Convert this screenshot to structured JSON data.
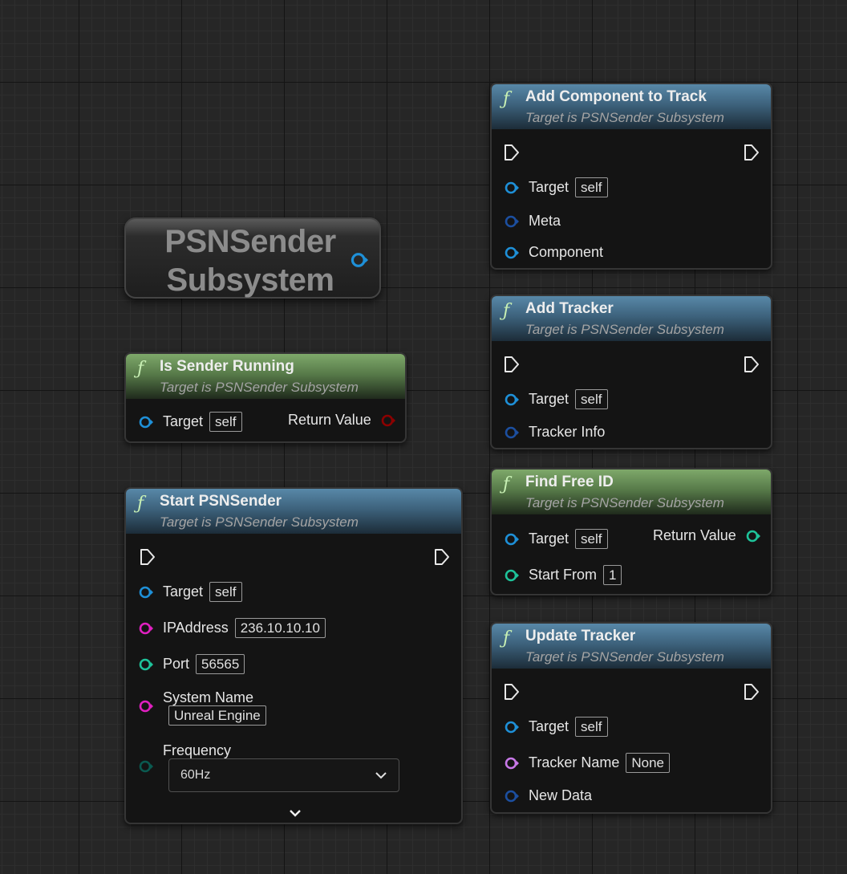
{
  "graph": {
    "subsystem_node": {
      "title_line1": "PSNSender",
      "title_line2": "Subsystem"
    },
    "is_sender_running": {
      "title": "Is Sender Running",
      "subtitle": "Target is PSNSender Subsystem",
      "target_label": "Target",
      "target_value": "self",
      "return_label": "Return Value"
    },
    "start_psn_sender": {
      "title": "Start PSNSender",
      "subtitle": "Target is PSNSender Subsystem",
      "target_label": "Target",
      "target_value": "self",
      "ip_label": "IPAddress",
      "ip_value": "236.10.10.10",
      "port_label": "Port",
      "port_value": "56565",
      "system_name_label": "System Name",
      "system_name_value": "Unreal Engine",
      "frequency_label": "Frequency",
      "frequency_value": "60Hz"
    },
    "add_component_to_track": {
      "title": "Add Component to Track",
      "subtitle": "Target is PSNSender Subsystem",
      "target_label": "Target",
      "target_value": "self",
      "meta_label": "Meta",
      "component_label": "Component"
    },
    "add_tracker": {
      "title": "Add Tracker",
      "subtitle": "Target is PSNSender Subsystem",
      "target_label": "Target",
      "target_value": "self",
      "tracker_info_label": "Tracker Info"
    },
    "find_free_id": {
      "title": "Find Free ID",
      "subtitle": "Target is PSNSender Subsystem",
      "target_label": "Target",
      "target_value": "self",
      "return_label": "Return Value",
      "start_from_label": "Start From",
      "start_from_value": "1"
    },
    "update_tracker": {
      "title": "Update Tracker",
      "subtitle": "Target is PSNSender Subsystem",
      "target_label": "Target",
      "target_value": "self",
      "tracker_name_label": "Tracker Name",
      "tracker_name_value": "None",
      "new_data_label": "New Data"
    }
  },
  "pin_colors": {
    "object": "#1e90d8",
    "struct": "#1c4fa0",
    "boolean": "#8c0000",
    "integer": "#1ec39a",
    "string": "#e020c0",
    "name": "#c878e8",
    "enum": "#0a5a50"
  },
  "header_colors": {
    "impure": "#3d627c",
    "pure": "#577a49"
  },
  "icons": {
    "function": "function-icon",
    "exec_pin": "exec-pin-icon",
    "expand": "chevron-down-icon",
    "dropdown": "chevron-down-icon"
  }
}
